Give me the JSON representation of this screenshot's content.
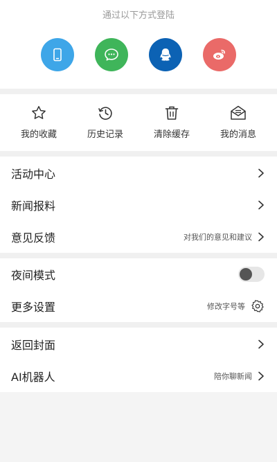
{
  "login": {
    "title": "通过以下方式登陆",
    "methods": [
      {
        "icon": "phone-icon",
        "color": "#3ea6e8"
      },
      {
        "icon": "wechat-icon",
        "color": "#3fb55a"
      },
      {
        "icon": "qq-icon",
        "color": "#0c62b4"
      },
      {
        "icon": "weibo-icon",
        "color": "#ea6a68"
      }
    ]
  },
  "quick_actions": [
    {
      "icon": "star-icon",
      "label": "我的收藏"
    },
    {
      "icon": "history-icon",
      "label": "历史记录"
    },
    {
      "icon": "trash-icon",
      "label": "清除缓存"
    },
    {
      "icon": "mail-icon",
      "label": "我的消息"
    }
  ],
  "menu": {
    "activity_center": "活动中心",
    "news_report": "新闻报料",
    "feedback": "意见反馈",
    "feedback_sub": "对我们的意见和建议",
    "night_mode": "夜间模式",
    "more_settings": "更多设置",
    "more_settings_sub": "修改字号等",
    "back_cover": "返回封面",
    "ai_robot": "AI机器人",
    "ai_robot_sub": "陪你聊新闻"
  },
  "colors": {
    "background": "#f4f4f4",
    "panel": "#ffffff",
    "text": "#222222"
  }
}
